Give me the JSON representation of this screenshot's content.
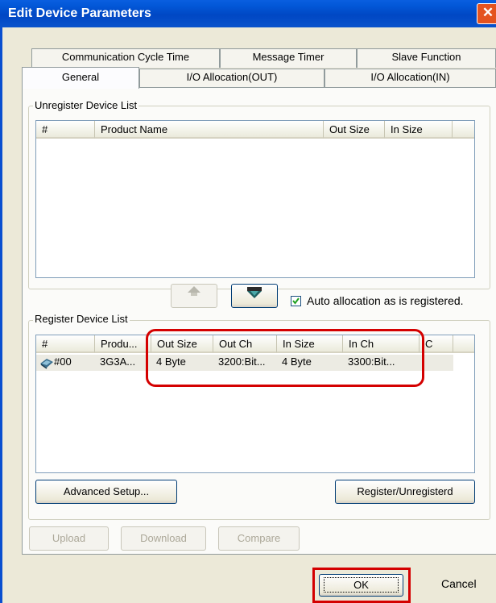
{
  "window": {
    "title": "Edit Device Parameters",
    "close_glyph": "✕"
  },
  "tabs": {
    "row1": [
      "Communication Cycle Time",
      "Message Timer",
      "Slave Function"
    ],
    "row2": [
      "General",
      "I/O Allocation(OUT)",
      "I/O Allocation(IN)"
    ],
    "active": "General"
  },
  "unregister": {
    "legend": "Unregister Device List",
    "columns": [
      "#",
      "Product Name",
      "Out Size",
      "In Size"
    ]
  },
  "register": {
    "legend": "Register Device List",
    "columns": [
      "#",
      "Produ...",
      "Out Size",
      "Out Ch",
      "In Size",
      "In Ch",
      "C"
    ],
    "rows": [
      {
        "id": "#00",
        "product": "3G3A...",
        "out_size": "4 Byte",
        "out_ch": "3200:Bit...",
        "in_size": "4 Byte",
        "in_ch": "3300:Bit..."
      }
    ]
  },
  "auto_allocation": {
    "label": "Auto allocation as is registered.",
    "checked": true
  },
  "buttons": {
    "advanced_setup": "Advanced Setup...",
    "register_unregister": "Register/Unregisterd",
    "upload": "Upload",
    "download": "Download",
    "compare": "Compare",
    "ok": "OK",
    "cancel": "Cancel"
  },
  "colors": {
    "highlight": "#d40000",
    "titlebar": "#0047c4"
  }
}
